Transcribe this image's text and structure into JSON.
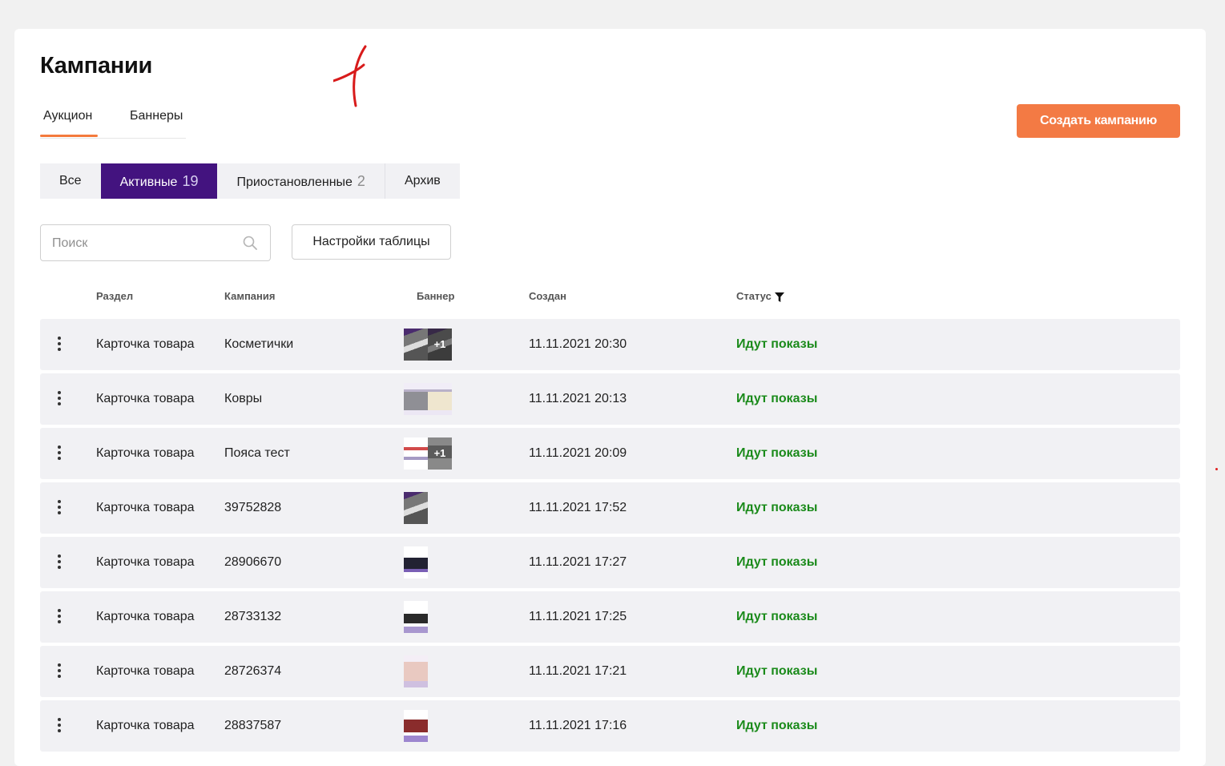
{
  "header": {
    "title": "Кампании",
    "create_button": "Создать кампанию"
  },
  "tabs": [
    {
      "label": "Аукцион",
      "active": true
    },
    {
      "label": "Баннеры",
      "active": false
    }
  ],
  "segments": [
    {
      "label": "Все",
      "count": ""
    },
    {
      "label": "Активные",
      "count": "19",
      "active": true
    },
    {
      "label": "Приостановленные",
      "count": "2"
    },
    {
      "label": "Архив",
      "count": ""
    }
  ],
  "search": {
    "placeholder": "Поиск"
  },
  "table_settings_label": "Настройки таблицы",
  "columns": {
    "section": "Раздел",
    "campaign": "Кампания",
    "banner": "Баннер",
    "created": "Создан",
    "status": "Статус"
  },
  "rows": [
    {
      "section": "Карточка товара",
      "campaign": "Косметички",
      "created": "11.11.2021 20:30",
      "status": "Идут показы",
      "banner_extra": "+1"
    },
    {
      "section": "Карточка товара",
      "campaign": "Ковры",
      "created": "11.11.2021 20:13",
      "status": "Идут показы",
      "banner_extra": ""
    },
    {
      "section": "Карточка товара",
      "campaign": "Пояса тест",
      "created": "11.11.2021 20:09",
      "status": "Идут показы",
      "banner_extra": "+1"
    },
    {
      "section": "Карточка товара",
      "campaign": "39752828",
      "created": "11.11.2021 17:52",
      "status": "Идут показы",
      "banner_extra": ""
    },
    {
      "section": "Карточка товара",
      "campaign": "28906670",
      "created": "11.11.2021 17:27",
      "status": "Идут показы",
      "banner_extra": ""
    },
    {
      "section": "Карточка товара",
      "campaign": "28733132",
      "created": "11.11.2021 17:25",
      "status": "Идут показы",
      "banner_extra": ""
    },
    {
      "section": "Карточка товара",
      "campaign": "28726374",
      "created": "11.11.2021 17:21",
      "status": "Идут показы",
      "banner_extra": ""
    },
    {
      "section": "Карточка товара",
      "campaign": "28837587",
      "created": "11.11.2021 17:16",
      "status": "Идут показы",
      "banner_extra": ""
    }
  ],
  "colors": {
    "accent_orange": "#f37a44",
    "active_segment": "#43137f",
    "status_green": "#1a8a1a"
  },
  "icons": {
    "search": "search-icon",
    "filter": "filter-icon",
    "row_menu": "kebab-menu-icon"
  }
}
